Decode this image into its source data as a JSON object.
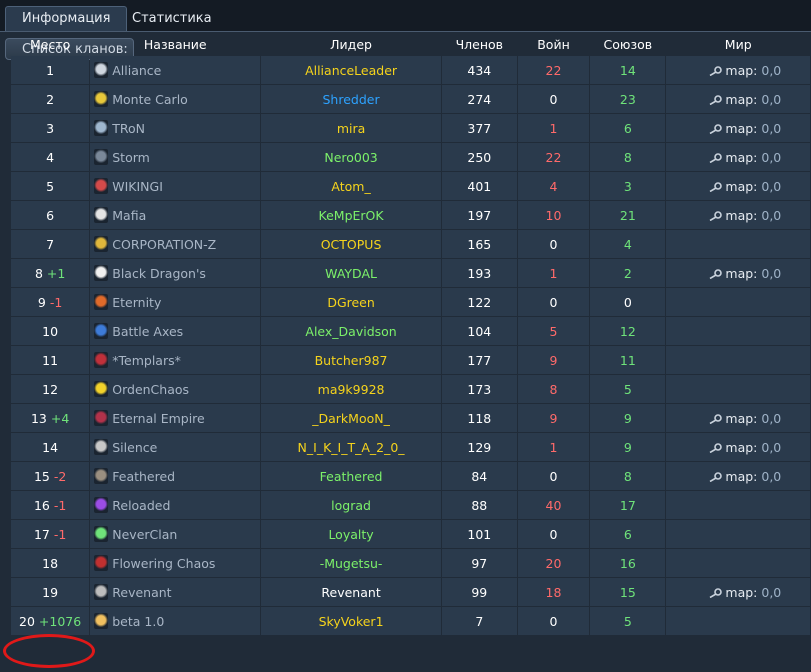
{
  "tabs": [
    {
      "label": "Информация",
      "active": true
    },
    {
      "label": "Статистика",
      "active": false
    }
  ],
  "section_title": "Список кланов:",
  "columns": [
    "Место",
    "Название",
    "Лидер",
    "Членов",
    "Войн",
    "Союзов",
    "Мир"
  ],
  "peace_label": "map:",
  "colors": {
    "leader_yellow": "#f5d31c",
    "leader_green": "#7cf16a",
    "leader_blue": "#2da2ff",
    "leader_white": "#ffffff",
    "wars_red": "#ff6a6a",
    "allies_green": "#6fe37a",
    "highlight_circle": "#e01919"
  },
  "rows": [
    {
      "rank": "1",
      "diff": "",
      "clan": "Alliance",
      "icon": "alliance-emblem-icon",
      "leader": "AllianceLeader",
      "leader_color": "yellow",
      "members": "434",
      "wars": "22",
      "allies": "14",
      "peace": "0,0"
    },
    {
      "rank": "2",
      "diff": "",
      "clan": "Monte Carlo",
      "icon": "monte-carlo-emblem-icon",
      "leader": "Shredder",
      "leader_color": "blue",
      "members": "274",
      "wars": "0",
      "allies": "23",
      "peace": "0,0"
    },
    {
      "rank": "3",
      "diff": "",
      "clan": "TRoN",
      "icon": "tron-emblem-icon",
      "leader": "mira",
      "leader_color": "yellow",
      "members": "377",
      "wars": "1",
      "allies": "6",
      "peace": "0,0"
    },
    {
      "rank": "4",
      "diff": "",
      "clan": "Storm",
      "icon": "storm-emblem-icon",
      "leader": "Nero003",
      "leader_color": "green",
      "members": "250",
      "wars": "22",
      "allies": "8",
      "peace": "0,0"
    },
    {
      "rank": "5",
      "diff": "",
      "clan": "WIKINGI",
      "icon": "wikingi-emblem-icon",
      "leader": "Atom_",
      "leader_color": "yellow",
      "members": "401",
      "wars": "4",
      "allies": "3",
      "peace": "0,0"
    },
    {
      "rank": "6",
      "diff": "",
      "clan": "Mafia",
      "icon": "mafia-emblem-icon",
      "leader": "KeMpErOK",
      "leader_color": "green",
      "members": "197",
      "wars": "10",
      "allies": "21",
      "peace": "0,0"
    },
    {
      "rank": "7",
      "diff": "",
      "clan": "CORPORATION-Z",
      "icon": "corporation-z-emblem-icon",
      "leader": "OCTOPUS",
      "leader_color": "yellow",
      "members": "165",
      "wars": "0",
      "allies": "4",
      "peace": ""
    },
    {
      "rank": "8",
      "diff": "+1",
      "clan": "Black Dragon's",
      "icon": "black-dragons-emblem-icon",
      "leader": "WAYDAL",
      "leader_color": "green",
      "members": "193",
      "wars": "1",
      "allies": "2",
      "peace": "0,0"
    },
    {
      "rank": "9",
      "diff": "-1",
      "clan": "Eternity",
      "icon": "eternity-emblem-icon",
      "leader": "DGreen",
      "leader_color": "yellow",
      "members": "122",
      "wars": "0",
      "allies": "0",
      "peace": ""
    },
    {
      "rank": "10",
      "diff": "",
      "clan": "Battle Axes",
      "icon": "battle-axes-emblem-icon",
      "leader": "Alex_Davidson",
      "leader_color": "green",
      "members": "104",
      "wars": "5",
      "allies": "12",
      "peace": ""
    },
    {
      "rank": "11",
      "diff": "",
      "clan": "*Templars*",
      "icon": "templars-emblem-icon",
      "leader": "Butcher987",
      "leader_color": "yellow",
      "members": "177",
      "wars": "9",
      "allies": "11",
      "peace": ""
    },
    {
      "rank": "12",
      "diff": "",
      "clan": "OrdenChaos",
      "icon": "ordenchaos-emblem-icon",
      "leader": "ma9k9928",
      "leader_color": "yellow",
      "members": "173",
      "wars": "8",
      "allies": "5",
      "peace": ""
    },
    {
      "rank": "13",
      "diff": "+4",
      "clan": "Eternal Empire",
      "icon": "eternal-empire-emblem-icon",
      "leader": "_DarkMooN_",
      "leader_color": "yellow",
      "members": "118",
      "wars": "9",
      "allies": "9",
      "peace": "0,0"
    },
    {
      "rank": "14",
      "diff": "",
      "clan": "Silence",
      "icon": "silence-emblem-icon",
      "leader": "N_I_K_I_T_A_2_0_",
      "leader_color": "yellow",
      "members": "129",
      "wars": "1",
      "allies": "9",
      "peace": "0,0"
    },
    {
      "rank": "15",
      "diff": "-2",
      "clan": "Feathered",
      "icon": "feathered-emblem-icon",
      "leader": "Feathered",
      "leader_color": "green",
      "members": "84",
      "wars": "0",
      "allies": "8",
      "peace": "0,0"
    },
    {
      "rank": "16",
      "diff": "-1",
      "clan": "Reloaded",
      "icon": "reloaded-emblem-icon",
      "leader": "lograd",
      "leader_color": "green",
      "members": "88",
      "wars": "40",
      "allies": "17",
      "peace": ""
    },
    {
      "rank": "17",
      "diff": "-1",
      "clan": "NeverClan",
      "icon": "neverclan-emblem-icon",
      "leader": "Loyalty",
      "leader_color": "green",
      "members": "101",
      "wars": "0",
      "allies": "6",
      "peace": ""
    },
    {
      "rank": "18",
      "diff": "",
      "clan": "Flowering Chaos",
      "icon": "flowering-chaos-emblem-icon",
      "leader": "-Mugetsu-",
      "leader_color": "green",
      "members": "97",
      "wars": "20",
      "allies": "16",
      "peace": ""
    },
    {
      "rank": "19",
      "diff": "",
      "clan": "Revenant",
      "icon": "revenant-emblem-icon",
      "leader": "Revenant",
      "leader_color": "white",
      "members": "99",
      "wars": "18",
      "allies": "15",
      "peace": "0,0"
    },
    {
      "rank": "20",
      "diff": "+1076",
      "clan": "beta 1.0",
      "icon": "beta-emblem-icon",
      "leader": "SkyVoker1",
      "leader_color": "yellow",
      "members": "7",
      "wars": "0",
      "allies": "5",
      "peace": ""
    }
  ]
}
